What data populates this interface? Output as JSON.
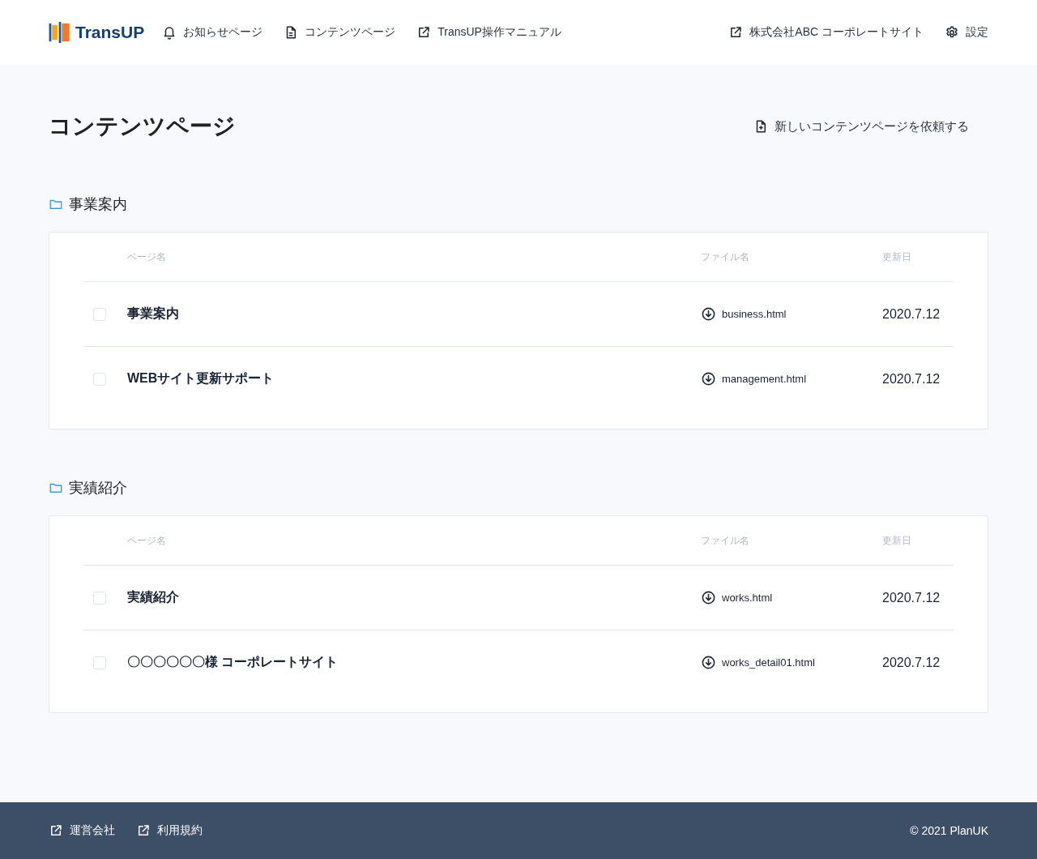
{
  "header": {
    "logo": "TransUP",
    "nav_left": [
      {
        "kind": "bell",
        "label": "お知らせページ"
      },
      {
        "kind": "document",
        "label": "コンテンツページ"
      },
      {
        "kind": "external",
        "label": "TransUP操作マニュアル"
      }
    ],
    "nav_right": [
      {
        "kind": "external",
        "label": "株式会社ABC コーポレートサイト"
      },
      {
        "kind": "gear",
        "label": "設定"
      }
    ]
  },
  "page": {
    "title": "コンテンツページ",
    "request_button": "新しいコンテンツページを依頼する"
  },
  "sections": [
    {
      "title": "事業案内",
      "columns": [
        "ページ名",
        "ファイル名",
        "更新日"
      ],
      "rows": [
        {
          "checked": false,
          "name": "事業案内",
          "file": "business.html",
          "date": "2020.7.12"
        },
        {
          "checked": false,
          "name": "WEBサイト更新サポート",
          "file": "management.html",
          "date": "2020.7.12"
        }
      ]
    },
    {
      "title": "実績紹介",
      "columns": [
        "ページ名",
        "ファイル名",
        "更新日"
      ],
      "rows": [
        {
          "checked": false,
          "name": "実績紹介",
          "file": "works.html",
          "date": "2020.7.12"
        },
        {
          "checked": false,
          "name": "〇〇〇〇〇〇様 コーポレートサイト",
          "file": "works_detail01.html",
          "date": "2020.7.12"
        }
      ]
    }
  ],
  "footer": {
    "links": [
      {
        "kind": "external",
        "label": "運営会社"
      },
      {
        "kind": "external",
        "label": "利用規約"
      }
    ],
    "copyright": "© 2021 PlanUK"
  }
}
